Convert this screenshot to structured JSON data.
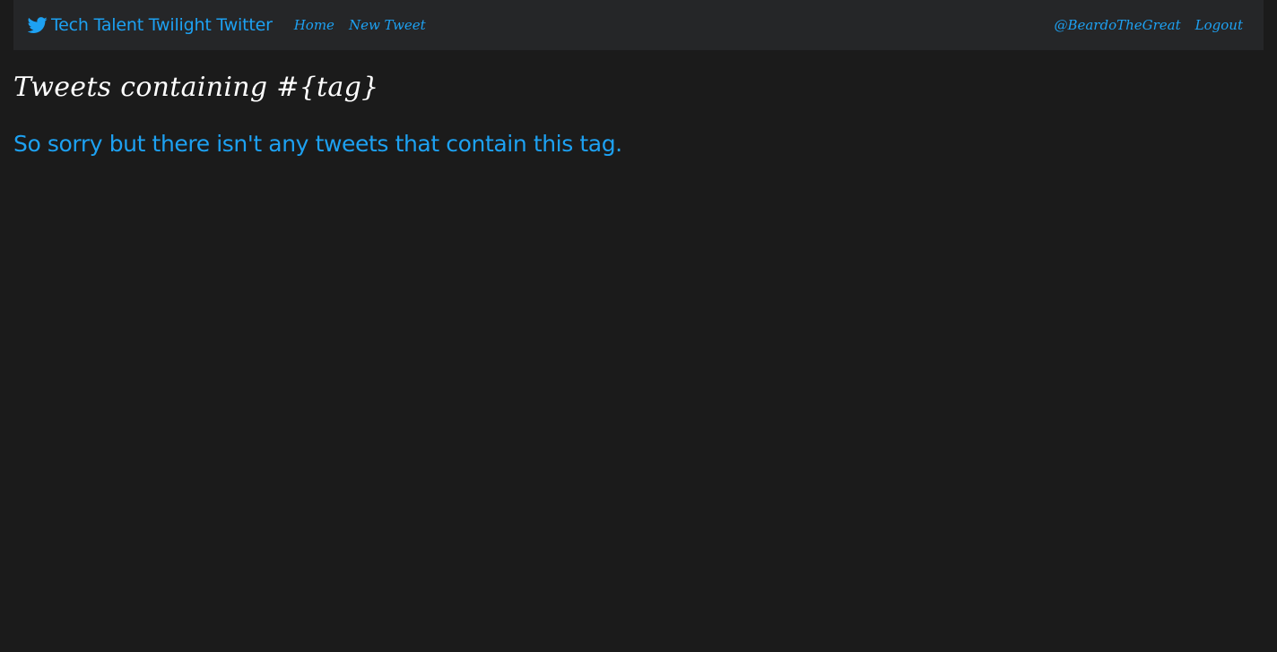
{
  "colors": {
    "accent": "#1da1f2",
    "background": "#1b1b1b",
    "navbar_background": "#252628",
    "title_text": "#ffffff"
  },
  "navbar": {
    "brand_icon": "twitter-bird-icon",
    "brand_label": "Tech Talent Twilight Twitter",
    "left_links": [
      {
        "label": "Home"
      },
      {
        "label": "New Tweet"
      }
    ],
    "right_links": [
      {
        "label": "@BeardoTheGreat"
      },
      {
        "label": "Logout"
      }
    ]
  },
  "main": {
    "title": "Tweets containing #{tag}",
    "empty_message": "So sorry but there isn't any tweets that contain this tag."
  }
}
